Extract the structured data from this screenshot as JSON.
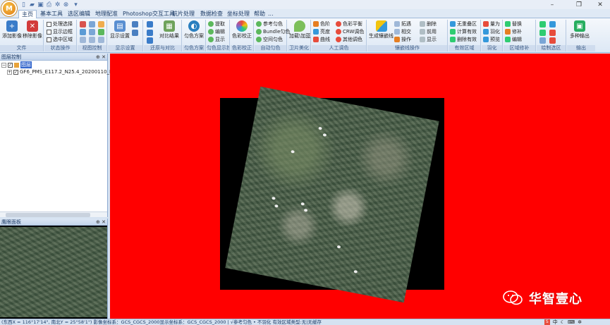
{
  "window": {
    "logo": "M",
    "controls": {
      "minimize": "–",
      "restore": "❐",
      "close": "✕"
    }
  },
  "tabs": [
    "主页",
    "基本工具",
    "选区编辑",
    "地理配准",
    "Photoshop交互工具",
    "航片处理",
    "数据检查",
    "坐标处理",
    "帮助",
    "..."
  ],
  "ribbon": {
    "file": {
      "label": "文件",
      "add": "添加影像",
      "remove": "移除影像"
    },
    "state": {
      "label": "状态操作",
      "items": [
        "处理选择",
        "显示边框",
        "选中区域"
      ]
    },
    "view": {
      "label": "视图控制"
    },
    "display": {
      "label": "显示设置",
      "btn": "显示设置"
    },
    "restore": {
      "label": "还原与对比",
      "btn": "对比结果"
    },
    "dodge": {
      "label": "匀色方案",
      "btn": "匀色方案"
    },
    "dodgedisplay": {
      "label": "匀色显示控制",
      "items": [
        "提取",
        "编辑",
        "显示"
      ]
    },
    "color": {
      "label": "色彩校正",
      "btn": "色彩校正"
    },
    "auto": {
      "label": "自动匀色",
      "items": [
        "参考匀色",
        "Bundle匀色",
        "空间匀色"
      ]
    },
    "beauty": {
      "label": "卫片美化",
      "btn": "加载\\加蓝"
    },
    "manual": {
      "label": "人工调色",
      "items": [
        "色阶",
        "亮度",
        "曲线",
        "色彩平衡",
        "CRW调色",
        "其他调色"
      ]
    },
    "mosaic": {
      "label": "镶嵌线操作",
      "btn": "生成镶嵌线",
      "items": [
        "拓遇",
        "相交",
        "操作",
        "删除",
        "前用",
        "显示"
      ]
    },
    "valid": {
      "label": "有效区域",
      "items": [
        "无重叠区",
        "计算有效",
        "删除有效"
      ]
    },
    "feather": {
      "label": "羽化",
      "items": [
        "羽化",
        "预览",
        "量为"
      ]
    },
    "area": {
      "label": "区域修补",
      "items": [
        "替换",
        "修补",
        "编辑"
      ]
    },
    "draw": {
      "label": "绘制选区"
    },
    "output": {
      "label": "输出",
      "btn": "多种输出"
    }
  },
  "layer_panel": {
    "title": "图层控制",
    "ctrls": "⊕ ✕",
    "root": "图层",
    "item": "GF6_PMS_E117.2_N25.4_20200110_L1"
  },
  "eagle_panel": {
    "title": "鹰眼面板",
    "ctrls": "⊕ ✕"
  },
  "watermark": {
    "text": "华智壹心"
  },
  "statusbar": {
    "text": "(东西X = 116°17'14\", 南北Y = 25°58'1\") 影像坐标系：GCS_CGCS_2000显示坐标系：GCS_CGCS_2000 | √参考匀色 • 不羽化 有效区域类型:无|无缓存"
  },
  "tray": {
    "ime": "中",
    "moon": "☾"
  }
}
